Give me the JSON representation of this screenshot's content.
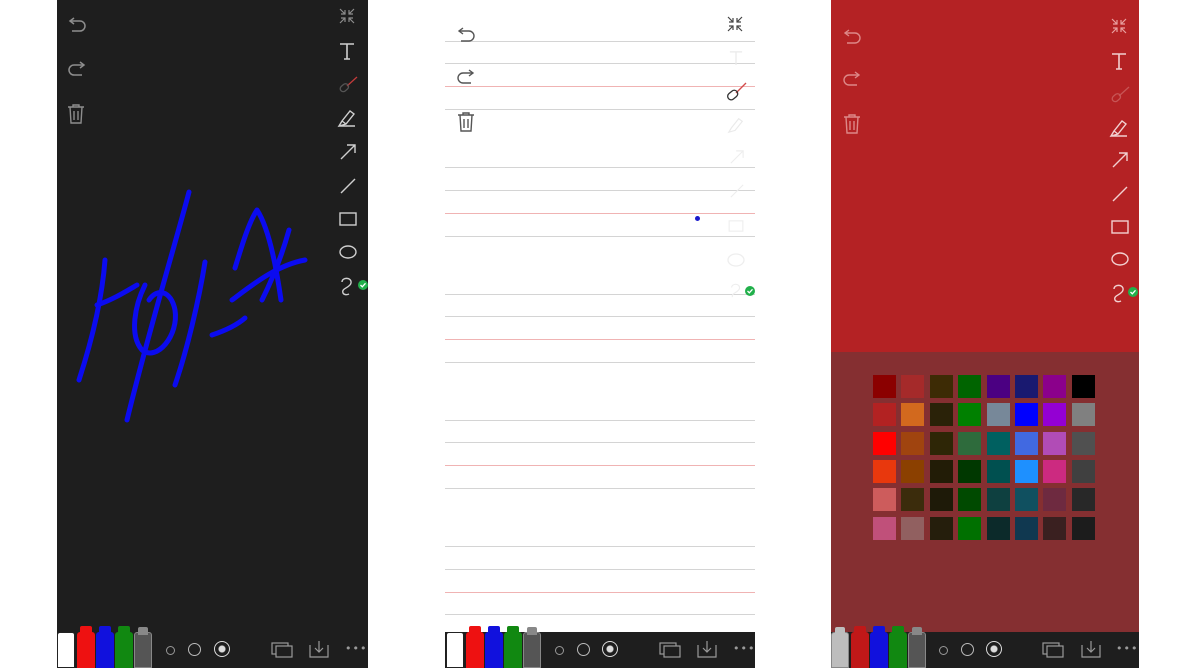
{
  "screens": [
    {
      "id": "dark-canvas",
      "background": "#1e1e1e",
      "handwriting_color": "#0b0bf0",
      "handwriting_text": "Hola"
    },
    {
      "id": "lined-canvas",
      "background": "#ffffff"
    },
    {
      "id": "color-picker",
      "background": "#b42224"
    }
  ],
  "toolbar_left": [
    "undo-icon",
    "redo-icon",
    "trash-icon"
  ],
  "toolbar_right": [
    "collapse-icon",
    "text-tool-icon",
    "laser-pointer-icon",
    "highlighter-icon",
    "arrow-tool-icon",
    "line-tool-icon",
    "rectangle-tool-icon",
    "ellipse-tool-icon",
    "freehand-tool-icon"
  ],
  "bottom_bar": {
    "pens": [
      "#ffffff",
      "#ee1111",
      "#1111dd",
      "#118811",
      "#555555"
    ],
    "brush_sizes": [
      "small",
      "medium",
      "large"
    ],
    "selected_size": "large",
    "more_label": "•••"
  },
  "palette": {
    "colors": [
      [
        "#8b0000",
        "#a52a2a",
        "#3d2b05",
        "#006400",
        "#4b0082",
        "#191970",
        "#8b008b",
        "#000000"
      ],
      [
        "#b22222",
        "#d2691e",
        "#2a2208",
        "#008000",
        "#778899",
        "#0000ff",
        "#9400d3",
        "#808080"
      ],
      [
        "#ff0000",
        "#a0440f",
        "#2e2606",
        "#2e6b3c",
        "#006060",
        "#4169e1",
        "#b14cb6",
        "#505050"
      ],
      [
        "#e8380d",
        "#8b4000",
        "#221c06",
        "#003800",
        "#005050",
        "#1e90ff",
        "#cc2a80",
        "#404040"
      ],
      [
        "#cd5c5c",
        "#3b2c0c",
        "#1e1a08",
        "#004a00",
        "#0e4040",
        "#105060",
        "#6e2a40",
        "#282828"
      ],
      [
        "#c0507a",
        "#916060",
        "#251e0c",
        "#007000",
        "#0c2a2a",
        "#103850",
        "#3a2020",
        "#1c1c1c"
      ]
    ]
  }
}
